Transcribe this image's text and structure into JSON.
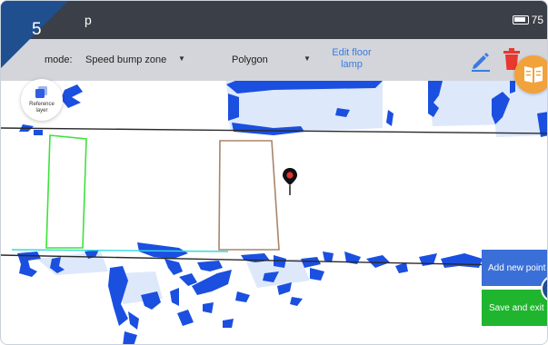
{
  "status_bar": {
    "title_fragment": "p",
    "battery_text": "75"
  },
  "toolbar": {
    "mode_label": "mode:",
    "zone_value": "Speed bump zone",
    "shape_value": "Polygon",
    "edit_line1": "Edit floor",
    "edit_line2": "lamp"
  },
  "step_badge": "5",
  "reference_layer": {
    "line1": "Reference",
    "line2": "layer"
  },
  "buttons": {
    "add_point": "Add new point",
    "save_exit": "Save and exit"
  },
  "colors": {
    "status_bar": "#3b3f47",
    "toolbar": "#d3d5da",
    "accent_blue": "#3a7be0",
    "delete_red": "#e8382f",
    "badge": "#1f4f8f",
    "guide": "#f2a23a",
    "obstacle": "#1a4fe0",
    "save_green": "#20b52e",
    "zone_green": "#3ee23a",
    "zone_brown": "#a8866a",
    "pin": "#e33232"
  }
}
